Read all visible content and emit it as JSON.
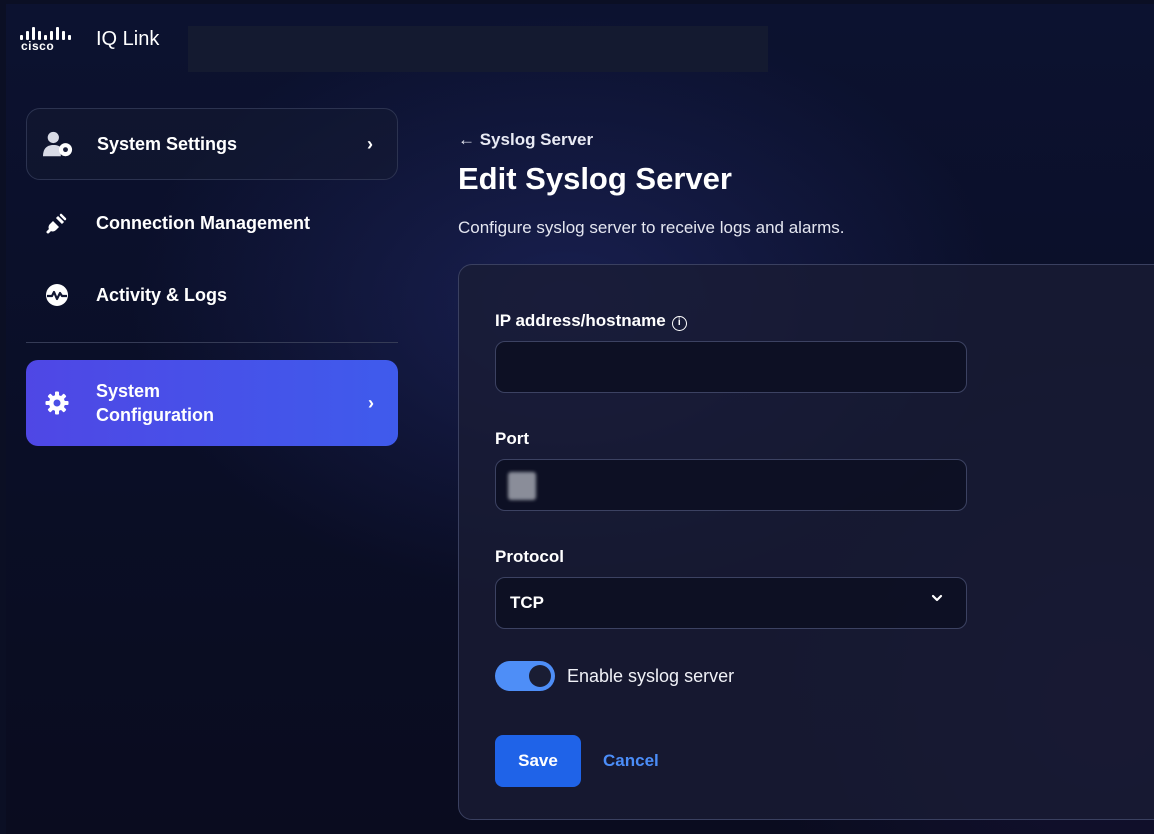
{
  "header": {
    "brand": "cisco",
    "app_title": "IQ Link"
  },
  "sidebar": {
    "items": [
      {
        "label": "System Settings",
        "icon": "user-gear-icon",
        "has_chevron": true
      },
      {
        "label": "Connection Management",
        "icon": "plug-icon",
        "has_chevron": false
      },
      {
        "label": "Activity & Logs",
        "icon": "activity-icon",
        "has_chevron": false
      },
      {
        "label_line1": "System",
        "label_line2": "Configuration",
        "icon": "gear-icon",
        "has_chevron": true,
        "active": true
      }
    ]
  },
  "main": {
    "back_link": "← Syslog Server",
    "title": "Edit Syslog Server",
    "description": "Configure syslog server to receive logs and alarms.",
    "form": {
      "ip_label": "IP address/hostname",
      "ip_value": "",
      "port_label": "Port",
      "protocol_label": "Protocol",
      "protocol_value": "TCP",
      "enable_label": "Enable syslog server",
      "enable_value": true,
      "save_label": "Save",
      "cancel_label": "Cancel"
    }
  },
  "colors": {
    "accent_active": "#4f47e5",
    "primary_button": "#1f63e8",
    "link": "#4b8df8",
    "toggle_on": "#4e8ef7"
  }
}
